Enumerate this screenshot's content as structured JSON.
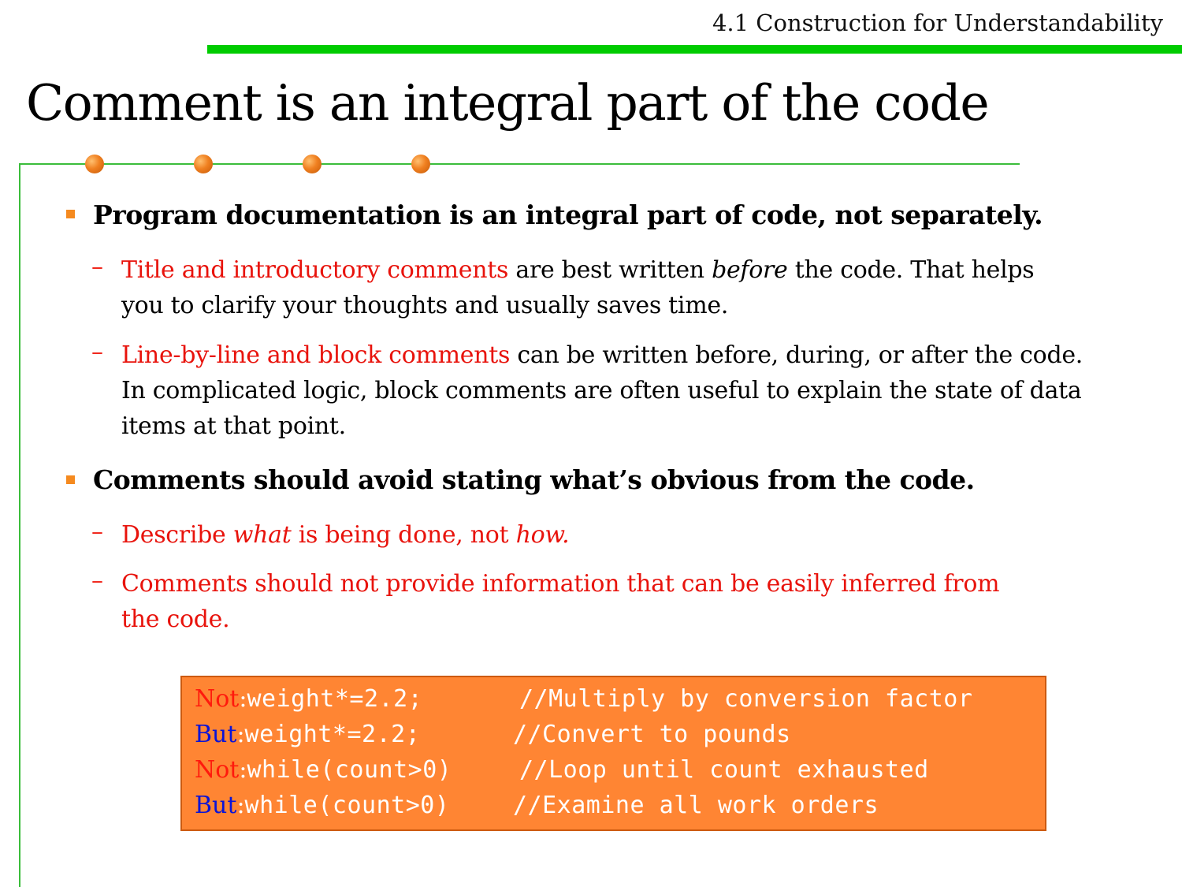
{
  "header": {
    "section_title": "4.1 Construction for Understandability"
  },
  "slide": {
    "title": "Comment is an integral part of the code"
  },
  "colors": {
    "header_bar": "#00cc00",
    "frame_line": "#3bbd3b",
    "dots": "#f08020",
    "bullet_marker": "#f58a1f",
    "highlight_red": "#e8130c",
    "code_box_bg": "#ff8533",
    "code_label_not": "#ff1a0d",
    "code_label_but": "#0a13d8"
  },
  "bullets": [
    {
      "text": "Program documentation is an integral part of code, not separately.",
      "subitems": [
        {
          "dash": "–",
          "red": "Title and introductory comments",
          "rest_a": " are best written ",
          "italic": "before",
          "rest_b": " the code. That helps you to clarify your thoughts and usually saves time."
        },
        {
          "dash": "–",
          "red": "Line-by-line and block comments",
          "rest_a": " can be written before, during, or after the code. In complicated logic, block comments are often useful to explain the state of data items at that point."
        }
      ]
    },
    {
      "text": "Comments should avoid stating what’s obvious from the code.",
      "subitems": [
        {
          "dash": "–",
          "part1": "Describe ",
          "italic1": "what",
          "part2": " is being done, not ",
          "italic2": "how."
        },
        {
          "dash": "–",
          "text": "Comments should not provide information that can be easily inferred from the code."
        }
      ]
    }
  ],
  "code_examples": [
    {
      "label": "Not",
      "colon": ":",
      "code": "weight*=2.2;",
      "comment": "//Multiply by conversion factor"
    },
    {
      "label": "But",
      "colon": ":",
      "code": "weight*=2.2;",
      "comment": "//Convert to pounds"
    },
    {
      "label": "Not",
      "colon": ":",
      "code": "while(count>0)",
      "comment": "//Loop until count exhausted"
    },
    {
      "label": "But",
      "colon": ":",
      "code": "while(count>0)",
      "comment": "//Examine all work orders"
    }
  ]
}
